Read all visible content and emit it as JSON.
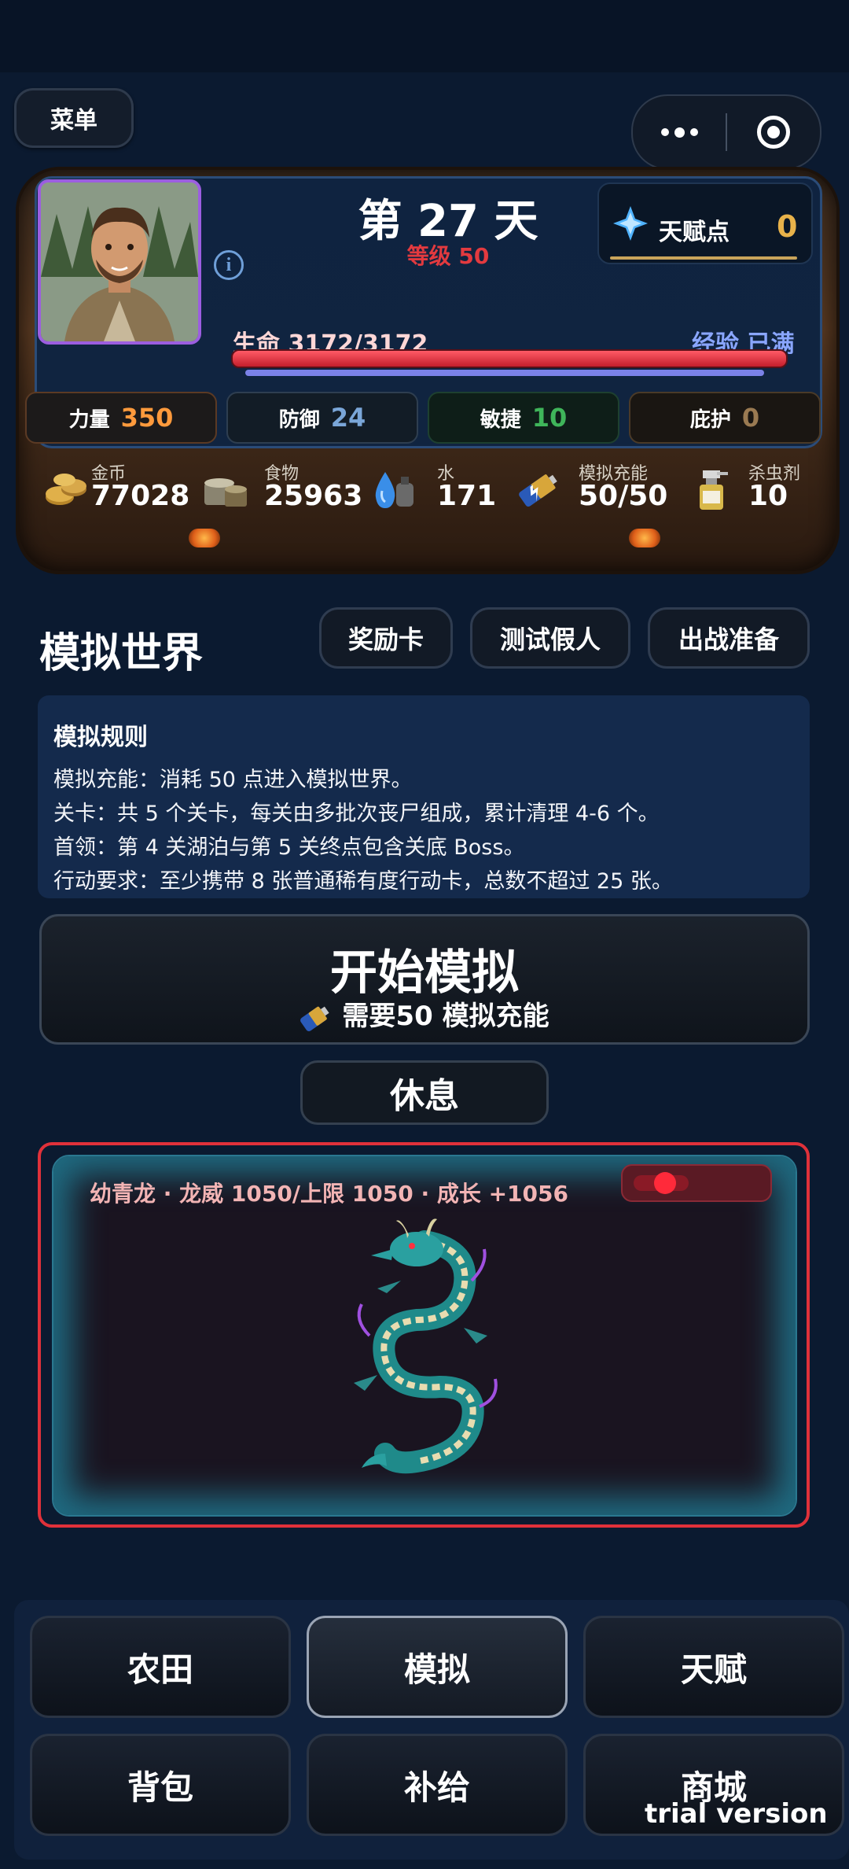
{
  "header": {
    "menu_label": "菜单"
  },
  "status": {
    "day": "第 27 天",
    "level": "等级 50",
    "talent_label": "天赋点",
    "talent_value": "0",
    "hp": "生命 3172/3172",
    "hp_fraction": 1.0,
    "exp": "经验 已满",
    "stats": [
      {
        "label": "力量",
        "value": "350",
        "color": "#ff9a3c"
      },
      {
        "label": "防御",
        "value": "24",
        "color": "#7aa6d8"
      },
      {
        "label": "敏捷",
        "value": "10",
        "color": "#3fb55a"
      },
      {
        "label": "庇护",
        "value": "0",
        "color": "#9a7a52"
      }
    ],
    "resources": [
      {
        "label": "金币",
        "value": "77028",
        "icon": "coins-icon"
      },
      {
        "label": "食物",
        "value": "25963",
        "icon": "food-can-icon"
      },
      {
        "label": "水",
        "value": "171",
        "icon": "water-drop-icon"
      },
      {
        "label": "模拟充能",
        "value": "50/50",
        "icon": "battery-icon"
      },
      {
        "label": "杀虫剂",
        "value": "10",
        "icon": "spray-icon"
      }
    ]
  },
  "simulation": {
    "title": "模拟世界",
    "buttons": [
      "奖励卡",
      "测试假人",
      "出战准备"
    ],
    "rules_title": "模拟规则",
    "rules": [
      "模拟充能：消耗 50 点进入模拟世界。",
      "关卡：共 5 个关卡，每关由多批次丧尸组成，累计清理 4-6 个。",
      "首领：第 4 关湖泊与第 5 关终点包含关底 Boss。",
      "行动要求：至少携带 8 张普通稀有度行动卡，总数不超过 25 张。"
    ],
    "start_label": "开始模拟",
    "start_sub": "需要50 模拟充能",
    "rest_label": "休息"
  },
  "pet": {
    "info": "幼青龙 · 龙威 1050/上限 1050 · 成长 +1056",
    "toggle_on": true
  },
  "nav": {
    "items": [
      "农田",
      "模拟",
      "天赋",
      "背包",
      "补给",
      "商城"
    ],
    "active": "模拟"
  },
  "watermark": "trial version"
}
